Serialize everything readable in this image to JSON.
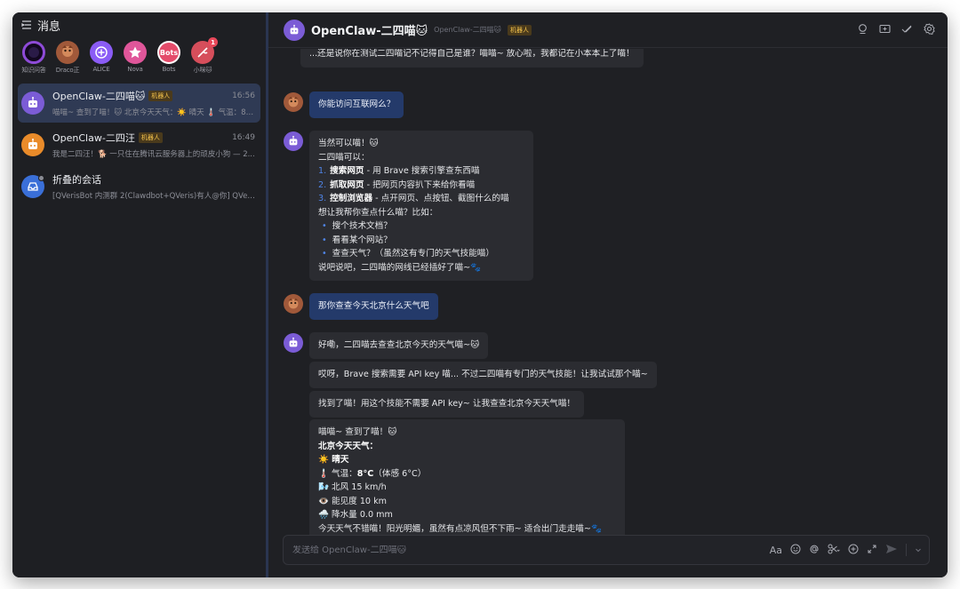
{
  "sidebar": {
    "title": "消息",
    "quick": [
      {
        "label": "知识问答",
        "color": "#2a1b47",
        "ring": "#8e4bd8",
        "text": "",
        "badge": ""
      },
      {
        "label": "Draco正",
        "color": "#a1593a",
        "ring": "",
        "text": "",
        "badge": ""
      },
      {
        "label": "ALICE",
        "color": "#8b5cf6",
        "ring": "",
        "text": "",
        "badge": ""
      },
      {
        "label": "Nova",
        "color": "#e0569a",
        "ring": "",
        "text": "",
        "badge": ""
      },
      {
        "label": "Bots",
        "color": "#e44b6a",
        "ring": "",
        "text": "Bots",
        "badge": ""
      },
      {
        "label": "小咪🐱",
        "color": "#d64e5b",
        "ring": "",
        "text": "",
        "badge": "1"
      }
    ],
    "conversations": [
      {
        "name": "OpenClaw-二四喵🐱",
        "tag": "机器人",
        "time": "16:56",
        "preview": "喵喵~ 查到了喵！🐱 北京今天天气：☀️ 晴天 🌡️ 气温：8°...",
        "color": "#7b5cd6"
      },
      {
        "name": "OpenClaw-二四汪",
        "tag": "机器人",
        "time": "16:49",
        "preview": "我是二四汪！🐕 一只住在腾讯云服务器上的顽皮小狗 — 2...",
        "color": "#e98b2a"
      },
      {
        "name": "折叠的会话",
        "tag": "",
        "time": "",
        "preview": "[QVerisBot 内测群 2(Clawdbot+QVeris)有人@你] QVeri...",
        "color": "#3a6fd8"
      }
    ]
  },
  "chat": {
    "title": "OpenClaw-二四喵🐱",
    "subtitle": "OpenClaw-二四喵🐱",
    "tag": "机器人",
    "input_placeholder": "发送给 OpenClaw-二四喵🐱",
    "messages": {
      "m0": "...还是说你在测试二四喵记不记得自己是谁？喵喵~ 放心啦，我都记在小本本上了喵！",
      "m1": "你能访问互联网么？",
      "m2": {
        "l1": "当然可以喵！🐱",
        "l2": "二四喵可以：",
        "items": [
          {
            "n": "1.",
            "b": "搜索网页",
            "t": " - 用 Brave 搜索引擎查东西喵"
          },
          {
            "n": "2.",
            "b": "抓取网页",
            "t": " - 把网页内容扒下来给你看喵"
          },
          {
            "n": "3.",
            "b": "控制浏览器",
            "t": " - 点开网页、点按钮、截图什么的喵"
          }
        ],
        "l3": "想让我帮你查点什么喵？比如：",
        "bullets": [
          "搜个技术文档？",
          "看看某个网站？",
          "查查天气？（虽然这有专门的天气技能喵）"
        ],
        "l4": "说吧说吧，二四喵的网线已经插好了喵~🐾"
      },
      "m3": "那你查查今天北京什么天气吧",
      "m4": "好嘞，二四喵去查查北京今天的天气喵~🐱",
      "m5": "哎呀，Brave 搜索需要 API key 喵... 不过二四喵有专门的天气技能！让我试试那个喵~",
      "m6": "找到了喵！用这个技能不需要 API key~ 让我查查北京今天天气喵！",
      "m7": {
        "l1": "喵喵~ 查到了喵！🐱",
        "l2": "北京今天天气：",
        "l3": "☀️ 晴天",
        "l4a": "🌡️ 气温：",
        "l4b": "8°C",
        "l4c": "（体感 6°C）",
        "l5": "🌬️ 北风 15 km/h",
        "l6": "👁️ 能见度 10 km",
        "l7": "🌧️ 降水量 0.0 mm",
        "l8": "今天天气不错喵！阳光明媚，虽然有点凉风但不下雨~ 适合出门走走喵~🐾"
      }
    }
  }
}
